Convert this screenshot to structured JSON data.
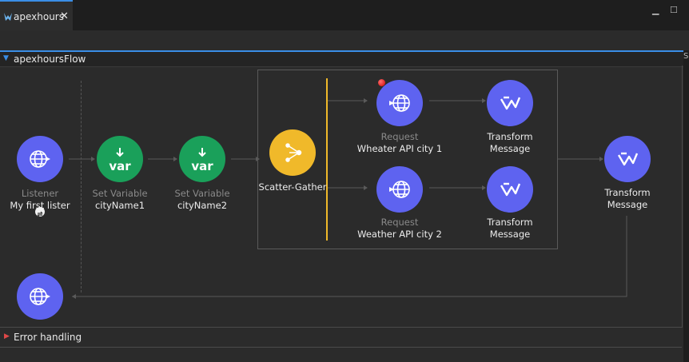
{
  "tab": {
    "title": "apexhours",
    "close": "✕"
  },
  "window": {
    "minimize": "▁",
    "maximize": "☐"
  },
  "flow": {
    "name": "apexhoursFlow",
    "error_handling": "Error handling",
    "right_edge_glyph": "S"
  },
  "nodes": {
    "listener": {
      "sub": "Listener",
      "main": "My first lister"
    },
    "setvar1": {
      "sub": "Set Variable",
      "main": "cityName1",
      "icon_text": "var"
    },
    "setvar2": {
      "sub": "Set Variable",
      "main": "cityName2",
      "icon_text": "var"
    },
    "scatter": {
      "main": "Scatter-Gather"
    },
    "request1": {
      "sub": "Request",
      "main": "Wheater API city 1"
    },
    "transform1": {
      "line1": "Transform",
      "line2": "Message"
    },
    "request2": {
      "sub": "Request",
      "main": "Weather API city 2"
    },
    "transform2": {
      "line1": "Transform",
      "line2": "Message"
    },
    "transform3": {
      "line1": "Transform",
      "line2": "Message"
    }
  },
  "colors": {
    "accent": "#3a8ee6",
    "connector_blue": "#5e63f0",
    "variable_green": "#1aa05a",
    "scatter_yellow": "#f0b92a",
    "breakpoint_red": "#d00000"
  }
}
